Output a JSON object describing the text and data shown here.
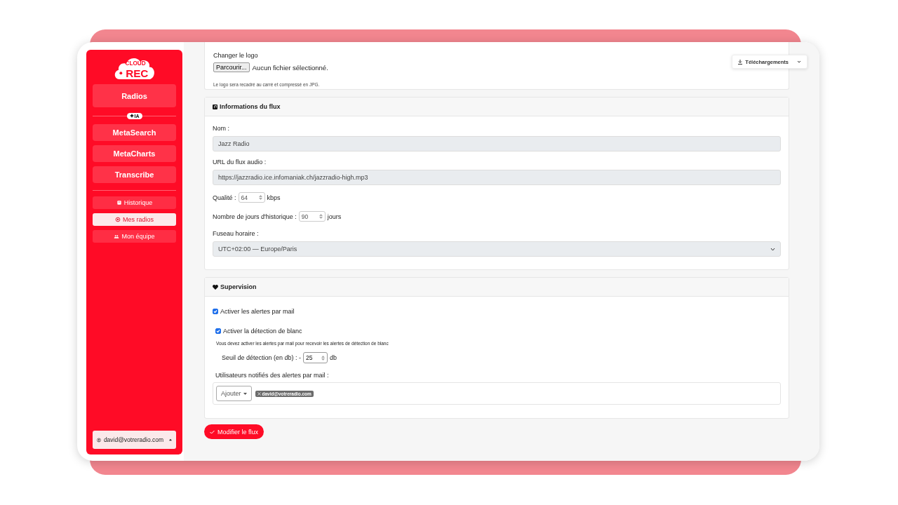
{
  "logo": {
    "small": "CLOUD",
    "big": "REC"
  },
  "sidebar": {
    "primary_item": "Radios",
    "ai_badge": "IA",
    "ai_items": [
      "MetaSearch",
      "MetaCharts",
      "Transcribe"
    ],
    "nav_items": [
      {
        "label": "Historique",
        "selected": false
      },
      {
        "label": "Mes radios",
        "selected": true
      },
      {
        "label": "Mon équipe",
        "selected": false
      }
    ],
    "user_menu": "david@votreradio.com"
  },
  "downloads_button": "Téléchargements",
  "logo_section": {
    "label": "Changer le logo",
    "browse_button": "Parcourir...",
    "file_status": "Aucun fichier sélectionné.",
    "hint": "Le logo sera recadré au carré et compressé en JPG."
  },
  "stream_info": {
    "title": "Informations du flux",
    "name_label": "Nom :",
    "name_value": "Jazz Radio",
    "url_label": "URL du flux audio :",
    "url_value": "https://jazzradio.ice.infomaniak.ch/jazzradio-high.mp3",
    "quality_label": "Qualité :",
    "quality_value": "64",
    "quality_unit": "kbps",
    "history_label": "Nombre de jours d'historique :",
    "history_value": "90",
    "history_unit": "jours",
    "timezone_label": "Fuseau horaire :",
    "timezone_value": "UTC+02:00 — Europe/Paris"
  },
  "supervision": {
    "title": "Supervision",
    "checkboxes": [
      {
        "label": "Activer les alertes par mail",
        "checked": true
      },
      {
        "label": "Activer la détection de blanc",
        "checked": true
      }
    ],
    "hint": "Vous devez activer les alertes par mail pour recevoir les alertes de détection de blanc",
    "threshold_label": "Seuil de détection (en db) : -",
    "threshold_value": "25",
    "threshold_unit": "db",
    "recipients_label": "Utilisateurs notifiés des alertes par mail :",
    "add_button": "Ajouter",
    "recipients": [
      "david@votreradio.com"
    ]
  },
  "submit_button": "Modifier le flux"
}
